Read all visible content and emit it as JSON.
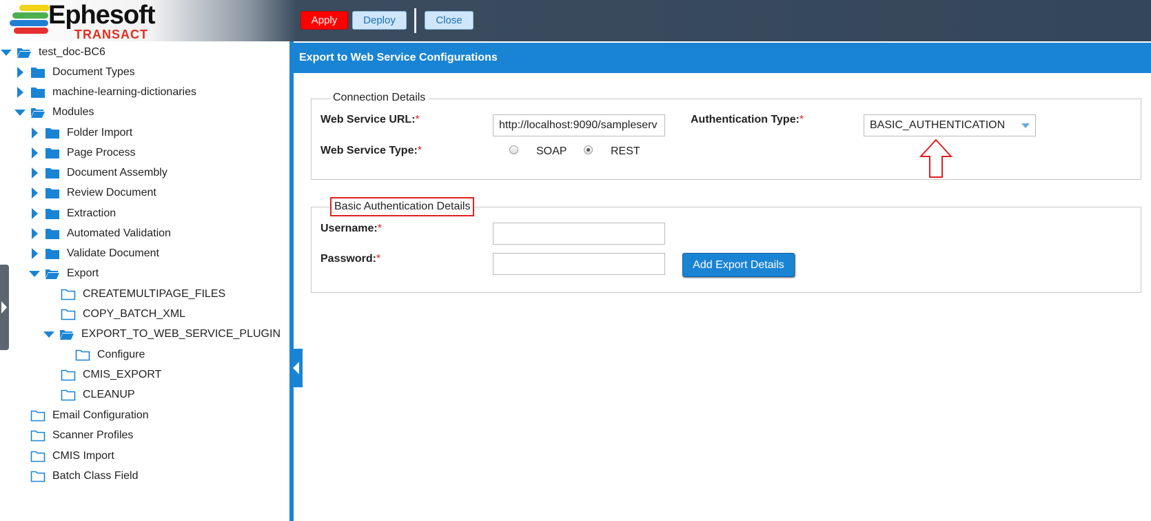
{
  "logo": {
    "name": "Ephesoft",
    "product": "TRANSACT"
  },
  "toolbar": {
    "apply": "Apply",
    "deploy": "Deploy",
    "close": "Close"
  },
  "tree": {
    "root": "test_doc-BC6",
    "items": [
      {
        "label": "Document Types"
      },
      {
        "label": "machine-learning-dictionaries"
      },
      {
        "label": "Modules"
      },
      {
        "label": "Folder Import"
      },
      {
        "label": "Page Process"
      },
      {
        "label": "Document Assembly"
      },
      {
        "label": "Review Document"
      },
      {
        "label": "Extraction"
      },
      {
        "label": "Automated Validation"
      },
      {
        "label": "Validate Document"
      },
      {
        "label": "Export"
      },
      {
        "label": "CREATEMULTIPAGE_FILES"
      },
      {
        "label": "COPY_BATCH_XML"
      },
      {
        "label": "EXPORT_TO_WEB_SERVICE_PLUGIN"
      },
      {
        "label": "Configure"
      },
      {
        "label": "CMIS_EXPORT"
      },
      {
        "label": "CLEANUP"
      },
      {
        "label": "Email Configuration"
      },
      {
        "label": "Scanner Profiles"
      },
      {
        "label": "CMIS Import"
      },
      {
        "label": "Batch Class Field"
      }
    ]
  },
  "panel": {
    "title": "Export to Web Service Configurations",
    "connection": {
      "legend": "Connection Details",
      "url_label": "Web Service URL:",
      "url_value": "http://localhost:9090/sampleserv",
      "type_label": "Web Service Type:",
      "type_options": [
        "SOAP",
        "REST"
      ],
      "type_selected": "REST",
      "auth_label": "Authentication Type:",
      "auth_value": "BASIC_AUTHENTICATION",
      "required_mark": "*"
    },
    "basic_auth": {
      "legend": "Basic Authentication Details",
      "username_label": "Username:",
      "username_value": "",
      "password_label": "Password:",
      "password_value": "",
      "add_button": "Add Export Details",
      "required_mark": "*"
    }
  },
  "colors": {
    "accent": "#1a84d4",
    "apply": "#ff0000",
    "annotation": "#e02020"
  }
}
